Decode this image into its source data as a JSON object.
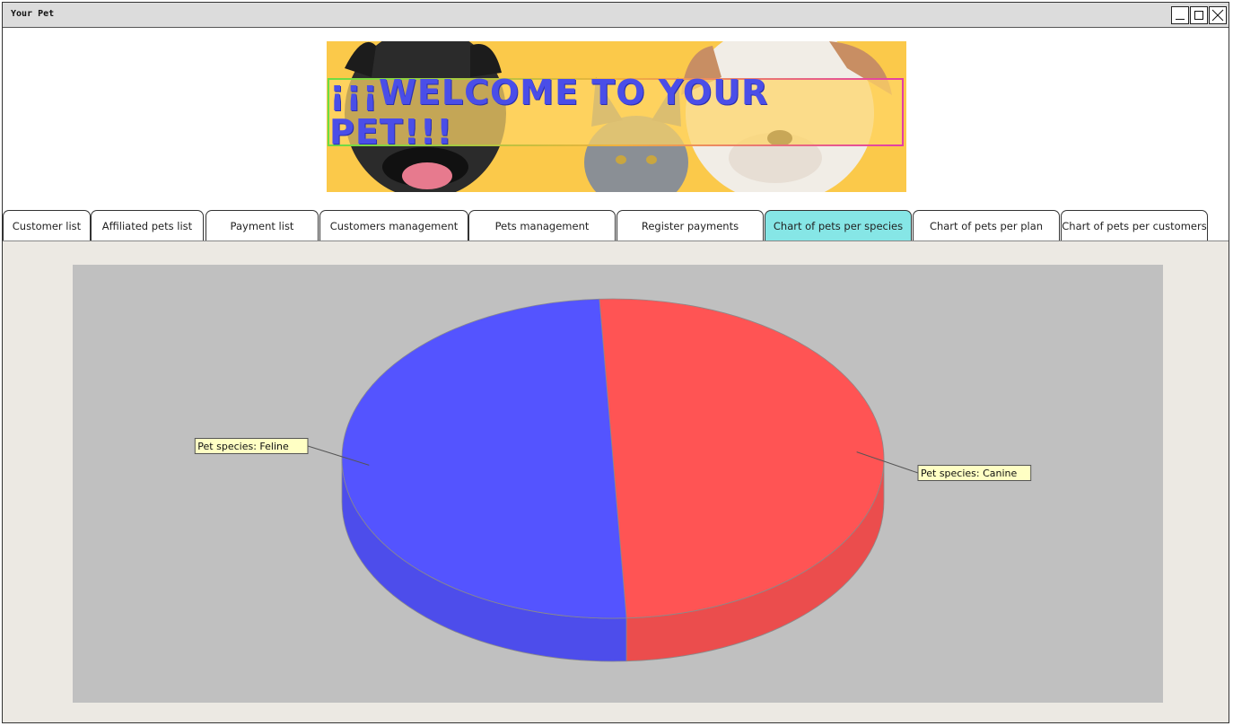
{
  "window": {
    "title": "Your Pet"
  },
  "banner": {
    "text": "¡¡¡WELCOME TO YOUR PET!!!"
  },
  "tabs": [
    {
      "label": "Customer list",
      "active": false
    },
    {
      "label": "Affiliated pets list",
      "active": false
    },
    {
      "label": "Payment list",
      "active": false
    },
    {
      "label": "Customers management",
      "active": false
    },
    {
      "label": "Pets management",
      "active": false
    },
    {
      "label": "Register payments",
      "active": false
    },
    {
      "label": "Chart of pets per species",
      "active": true
    },
    {
      "label": "Chart of pets per plan",
      "active": false
    },
    {
      "label": "Chart of pets per customers",
      "active": false
    }
  ],
  "colors": {
    "active_tab": "#86e6e6",
    "canine": "#ff5454",
    "feline": "#5454ff",
    "chart_bg": "#c0c0c0",
    "label_bg": "#ffffc4"
  },
  "chart_data": {
    "type": "pie",
    "style": "3d",
    "title": "",
    "series": [
      {
        "name": "Pet species: Canine",
        "value": 1,
        "color": "#ff5454"
      },
      {
        "name": "Pet species: Feline",
        "value": 1,
        "color": "#5454ff"
      }
    ],
    "labels_placement": "outside-with-leader-lines",
    "legend": "none"
  }
}
